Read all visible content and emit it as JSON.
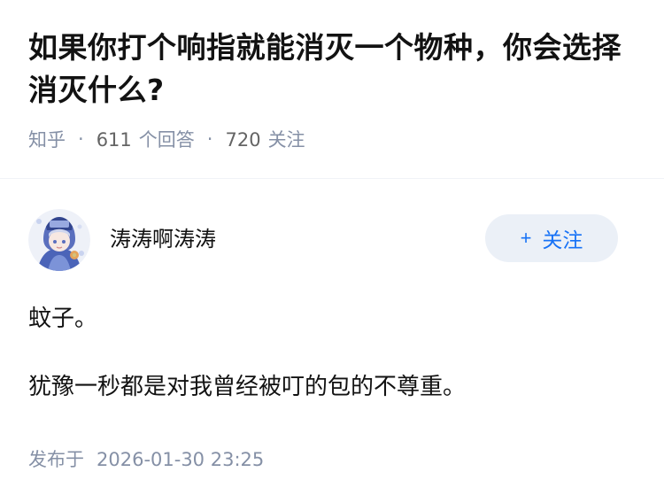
{
  "question": {
    "title": "如果你打个响指就能消灭一个物种，你会选择消灭什么?",
    "source": "知乎",
    "answers_count": "611",
    "answers_label": "个回答",
    "followers_count": "720",
    "followers_label": "关注",
    "separator": "·"
  },
  "answer": {
    "author_name": "涛涛啊涛涛",
    "follow_plus": "+",
    "follow_label": "关注",
    "paragraphs": [
      "蚊子。",
      "犹豫一秒都是对我曾经被叮的包的不尊重。"
    ],
    "published_label": "发布于",
    "published_time": "2026-01-30 23:25"
  },
  "colors": {
    "accent": "#1772f6",
    "follow_bg": "#ebf0f7",
    "meta": "#8590a6",
    "text": "#121212"
  },
  "icons": {
    "avatar": "anime-avatar"
  }
}
